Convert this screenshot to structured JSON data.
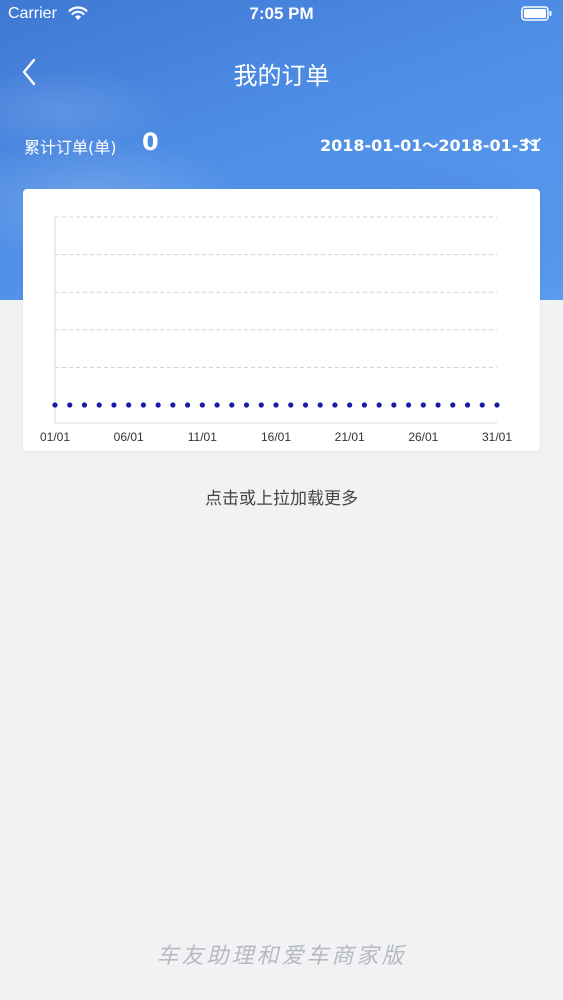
{
  "status_bar": {
    "carrier": "Carrier",
    "time": "7:05 PM"
  },
  "nav": {
    "title": "我的订单",
    "back_icon": "chevron-left-icon"
  },
  "summary": {
    "label": "累计订单(单)",
    "count": "0",
    "date_range": "2018-01-01～2018-01-31"
  },
  "chart_data": {
    "type": "scatter",
    "x": [
      "01/01",
      "02/01",
      "03/01",
      "04/01",
      "05/01",
      "06/01",
      "07/01",
      "08/01",
      "09/01",
      "10/01",
      "11/01",
      "12/01",
      "13/01",
      "14/01",
      "15/01",
      "16/01",
      "17/01",
      "18/01",
      "19/01",
      "20/01",
      "21/01",
      "22/01",
      "23/01",
      "24/01",
      "25/01",
      "26/01",
      "27/01",
      "28/01",
      "29/01",
      "30/01",
      "31/01"
    ],
    "values": [
      0,
      0,
      0,
      0,
      0,
      0,
      0,
      0,
      0,
      0,
      0,
      0,
      0,
      0,
      0,
      0,
      0,
      0,
      0,
      0,
      0,
      0,
      0,
      0,
      0,
      0,
      0,
      0,
      0,
      0,
      0
    ],
    "x_tick_labels": [
      "01/01",
      "06/01",
      "11/01",
      "16/01",
      "21/01",
      "26/01",
      "31/01"
    ],
    "title": "",
    "xlabel": "",
    "ylabel": "",
    "ylim": [
      0,
      5
    ],
    "grid": true,
    "color": "#1a1aa8"
  },
  "load_more": "点击或上拉加载更多",
  "footer": "车友助理和爱车商家版",
  "colors": {
    "header_blue": "#4a86dd",
    "background": "#f1f2f4",
    "point": "#1a1aa8"
  }
}
